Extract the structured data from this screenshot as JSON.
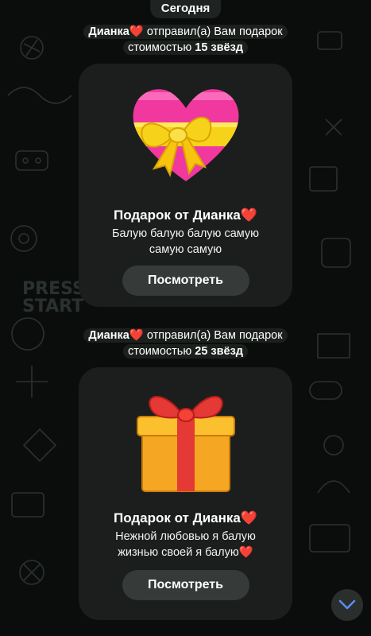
{
  "date_label": "Сегодня",
  "messages": [
    {
      "sender": "Дианка",
      "heart": "❤️",
      "action": "отправил(а) Вам подарок",
      "cost_prefix": "стоимостью",
      "cost": "15 звёзд",
      "gift": {
        "icon": "heart-gift-icon",
        "title": "Подарок от Дианка",
        "title_heart": "❤️",
        "line1": "Балую балую балую самую",
        "line2": "самую самую",
        "line2_heart": "",
        "button": "Посмотреть"
      }
    },
    {
      "sender": "Дианка",
      "heart": "❤️",
      "action": "отправил(а) Вам подарок",
      "cost_prefix": "стоимостью",
      "cost": "25 звёзд",
      "gift": {
        "icon": "gift-box-icon",
        "title": "Подарок от Дианка",
        "title_heart": "❤️",
        "line1": "Нежной любовью я балую",
        "line2": "жизнью своей я балую",
        "line2_heart": "❤️",
        "button": "Посмотреть"
      }
    }
  ],
  "colors": {
    "background": "#0b0d0c",
    "card": "#1b1e1d",
    "button": "#363a39",
    "accent": "#5b8def"
  },
  "scroll_button_icon": "chevron-down-icon"
}
